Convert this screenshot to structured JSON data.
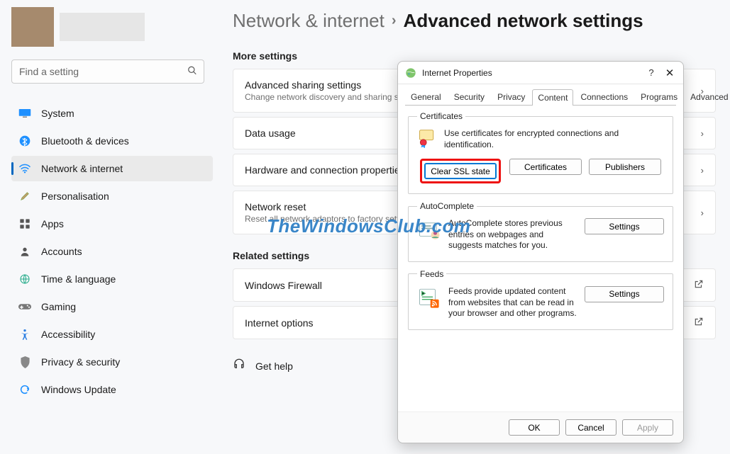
{
  "search": {
    "placeholder": "Find a setting"
  },
  "sidebar": {
    "items": [
      {
        "label": "System",
        "icon": "🖥️"
      },
      {
        "label": "Bluetooth & devices",
        "icon": "bt"
      },
      {
        "label": "Network & internet",
        "icon": "wifi"
      },
      {
        "label": "Personalisation",
        "icon": "🖌️"
      },
      {
        "label": "Apps",
        "icon": "▦"
      },
      {
        "label": "Accounts",
        "icon": "👤"
      },
      {
        "label": "Time & language",
        "icon": "🌐"
      },
      {
        "label": "Gaming",
        "icon": "🎮"
      },
      {
        "label": "Accessibility",
        "icon": "✶"
      },
      {
        "label": "Privacy & security",
        "icon": "🛡"
      },
      {
        "label": "Windows Update",
        "icon": "🔄"
      }
    ]
  },
  "breadcrumb": {
    "parent": "Network & internet",
    "current": "Advanced network settings"
  },
  "sections": {
    "more": "More settings",
    "related": "Related settings"
  },
  "cards": {
    "advSharing": {
      "title": "Advanced sharing settings",
      "sub": "Change network discovery and sharing settings"
    },
    "dataUsage": {
      "title": "Data usage"
    },
    "hardware": {
      "title": "Hardware and connection properties"
    },
    "netReset": {
      "title": "Network reset",
      "sub": "Reset all network adaptors to factory settings"
    },
    "firewall": {
      "title": "Windows Firewall"
    },
    "inetOpts": {
      "title": "Internet options"
    }
  },
  "help": {
    "label": "Get help"
  },
  "dialog": {
    "title": "Internet Properties",
    "tabs": [
      "General",
      "Security",
      "Privacy",
      "Content",
      "Connections",
      "Programs",
      "Advanced"
    ],
    "cert": {
      "legend": "Certificates",
      "desc": "Use certificates for encrypted connections and identification.",
      "clear": "Clear SSL state",
      "certs": "Certificates",
      "pubs": "Publishers"
    },
    "ac": {
      "legend": "AutoComplete",
      "desc": "AutoComplete stores previous entries on webpages and suggests matches for you.",
      "btn": "Settings"
    },
    "feeds": {
      "legend": "Feeds",
      "desc": "Feeds provide updated content from websites that can be read in your browser and other programs.",
      "btn": "Settings"
    },
    "footer": {
      "ok": "OK",
      "cancel": "Cancel",
      "apply": "Apply"
    }
  },
  "watermark": "TheWindowsClub.com"
}
